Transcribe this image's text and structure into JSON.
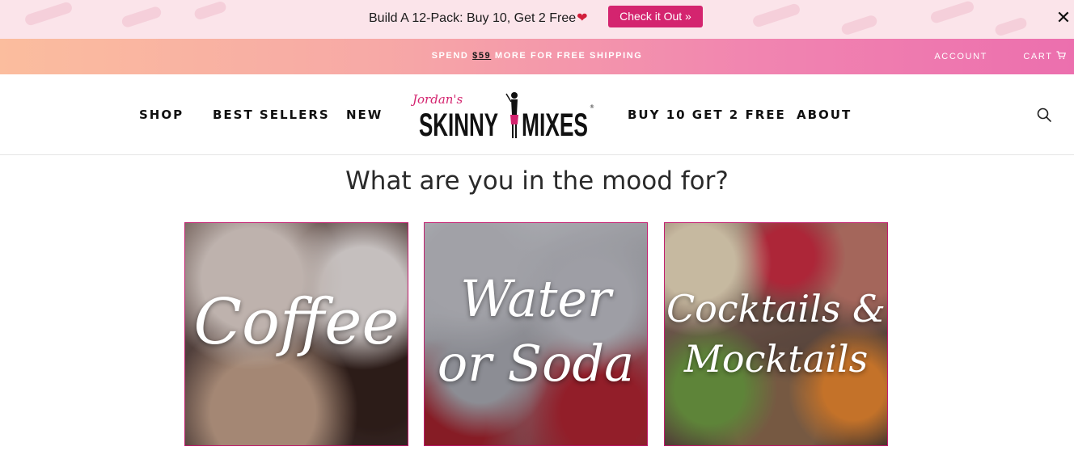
{
  "promo": {
    "text": "Build A 12-Pack: Buy 10, Get 2 Free",
    "heart_icon": "broken-heart-icon",
    "cta_label": "Check it Out »",
    "close_icon": "close-icon",
    "accent_color": "#d4246f"
  },
  "shipping": {
    "prefix": "SPEND ",
    "amount": "$59",
    "suffix": " MORE FOR FREE SHIPPING",
    "account_label": "ACCOUNT",
    "cart_label": "CART",
    "cart_icon": "cart-icon"
  },
  "nav": {
    "shop": "SHOP",
    "best_sellers": "BEST SELLERS",
    "new": "NEW",
    "buy10": "BUY 10 GET 2 FREE",
    "about": "ABOUT",
    "logo_script": "Jordan's",
    "logo_word1": "SKINNY",
    "logo_word2": "MIXES",
    "search_icon": "search-icon"
  },
  "main": {
    "heading": "What are you in the mood for?",
    "tiles": [
      {
        "line1": "Coffee",
        "line2": ""
      },
      {
        "line1": "Water",
        "line2": "or Soda"
      },
      {
        "line1": "Cocktails &",
        "line2": "Mocktails"
      }
    ]
  }
}
